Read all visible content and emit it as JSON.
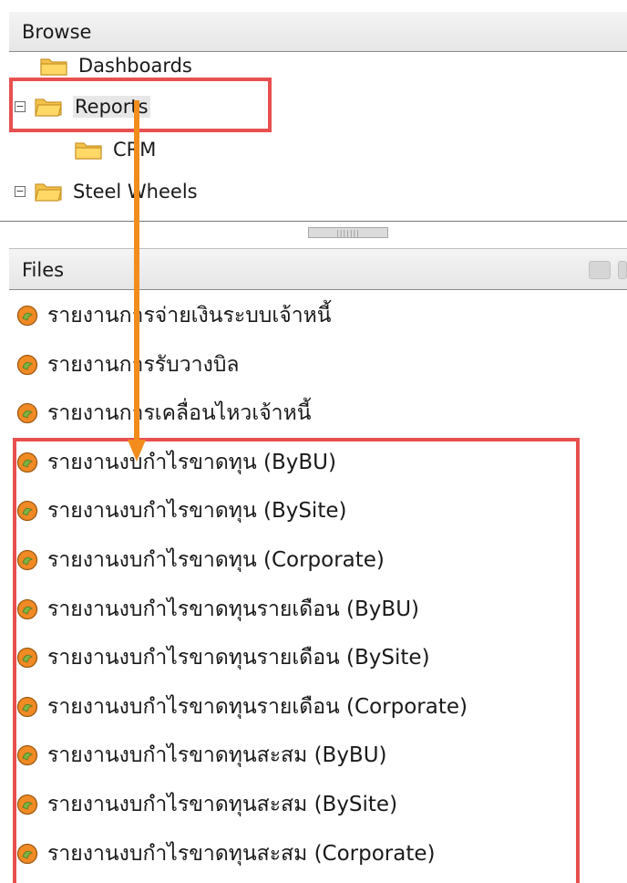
{
  "browse": {
    "title": "Browse",
    "tree": [
      {
        "label": "Dashboards",
        "expanded": null,
        "level": 1
      },
      {
        "label": "Reports",
        "expanded": true,
        "level": 0,
        "selected": true
      },
      {
        "label": "CRM",
        "expanded": null,
        "level": 2
      },
      {
        "label": "Steel Wheels",
        "expanded": true,
        "level": 0
      }
    ]
  },
  "files": {
    "title": "Files",
    "items": [
      "รายงานการจ่ายเงินระบบเจ้าหนี้",
      "รายงานการรับวางบิล",
      "รายงานการเคลื่อนไหวเจ้าหนี้",
      "รายงานงบกำไรขาดทุน (ByBU)",
      "รายงานงบกำไรขาดทุน (BySite)",
      "รายงานงบกำไรขาดทุน (Corporate)",
      "รายงานงบกำไรขาดทุนรายเดือน (ByBU)",
      "รายงานงบกำไรขาดทุนรายเดือน (BySite)",
      "รายงานงบกำไรขาดทุนรายเดือน (Corporate)",
      "รายงานงบกำไรขาดทุนสะสม (ByBU)",
      "รายงานงบกำไรขาดทุนสะสม (BySite)",
      "รายงานงบกำไรขาดทุนสะสม (Corporate)"
    ]
  },
  "icons": {
    "folder": "folder-icon",
    "toggle_expanded": "collapse-icon",
    "report": "report-icon",
    "toolbar": [
      "edit-icon",
      "action-icon"
    ]
  },
  "colors": {
    "highlight": "#e8504f",
    "arrow": "#f28c1c",
    "folder": "#f3c24a"
  }
}
